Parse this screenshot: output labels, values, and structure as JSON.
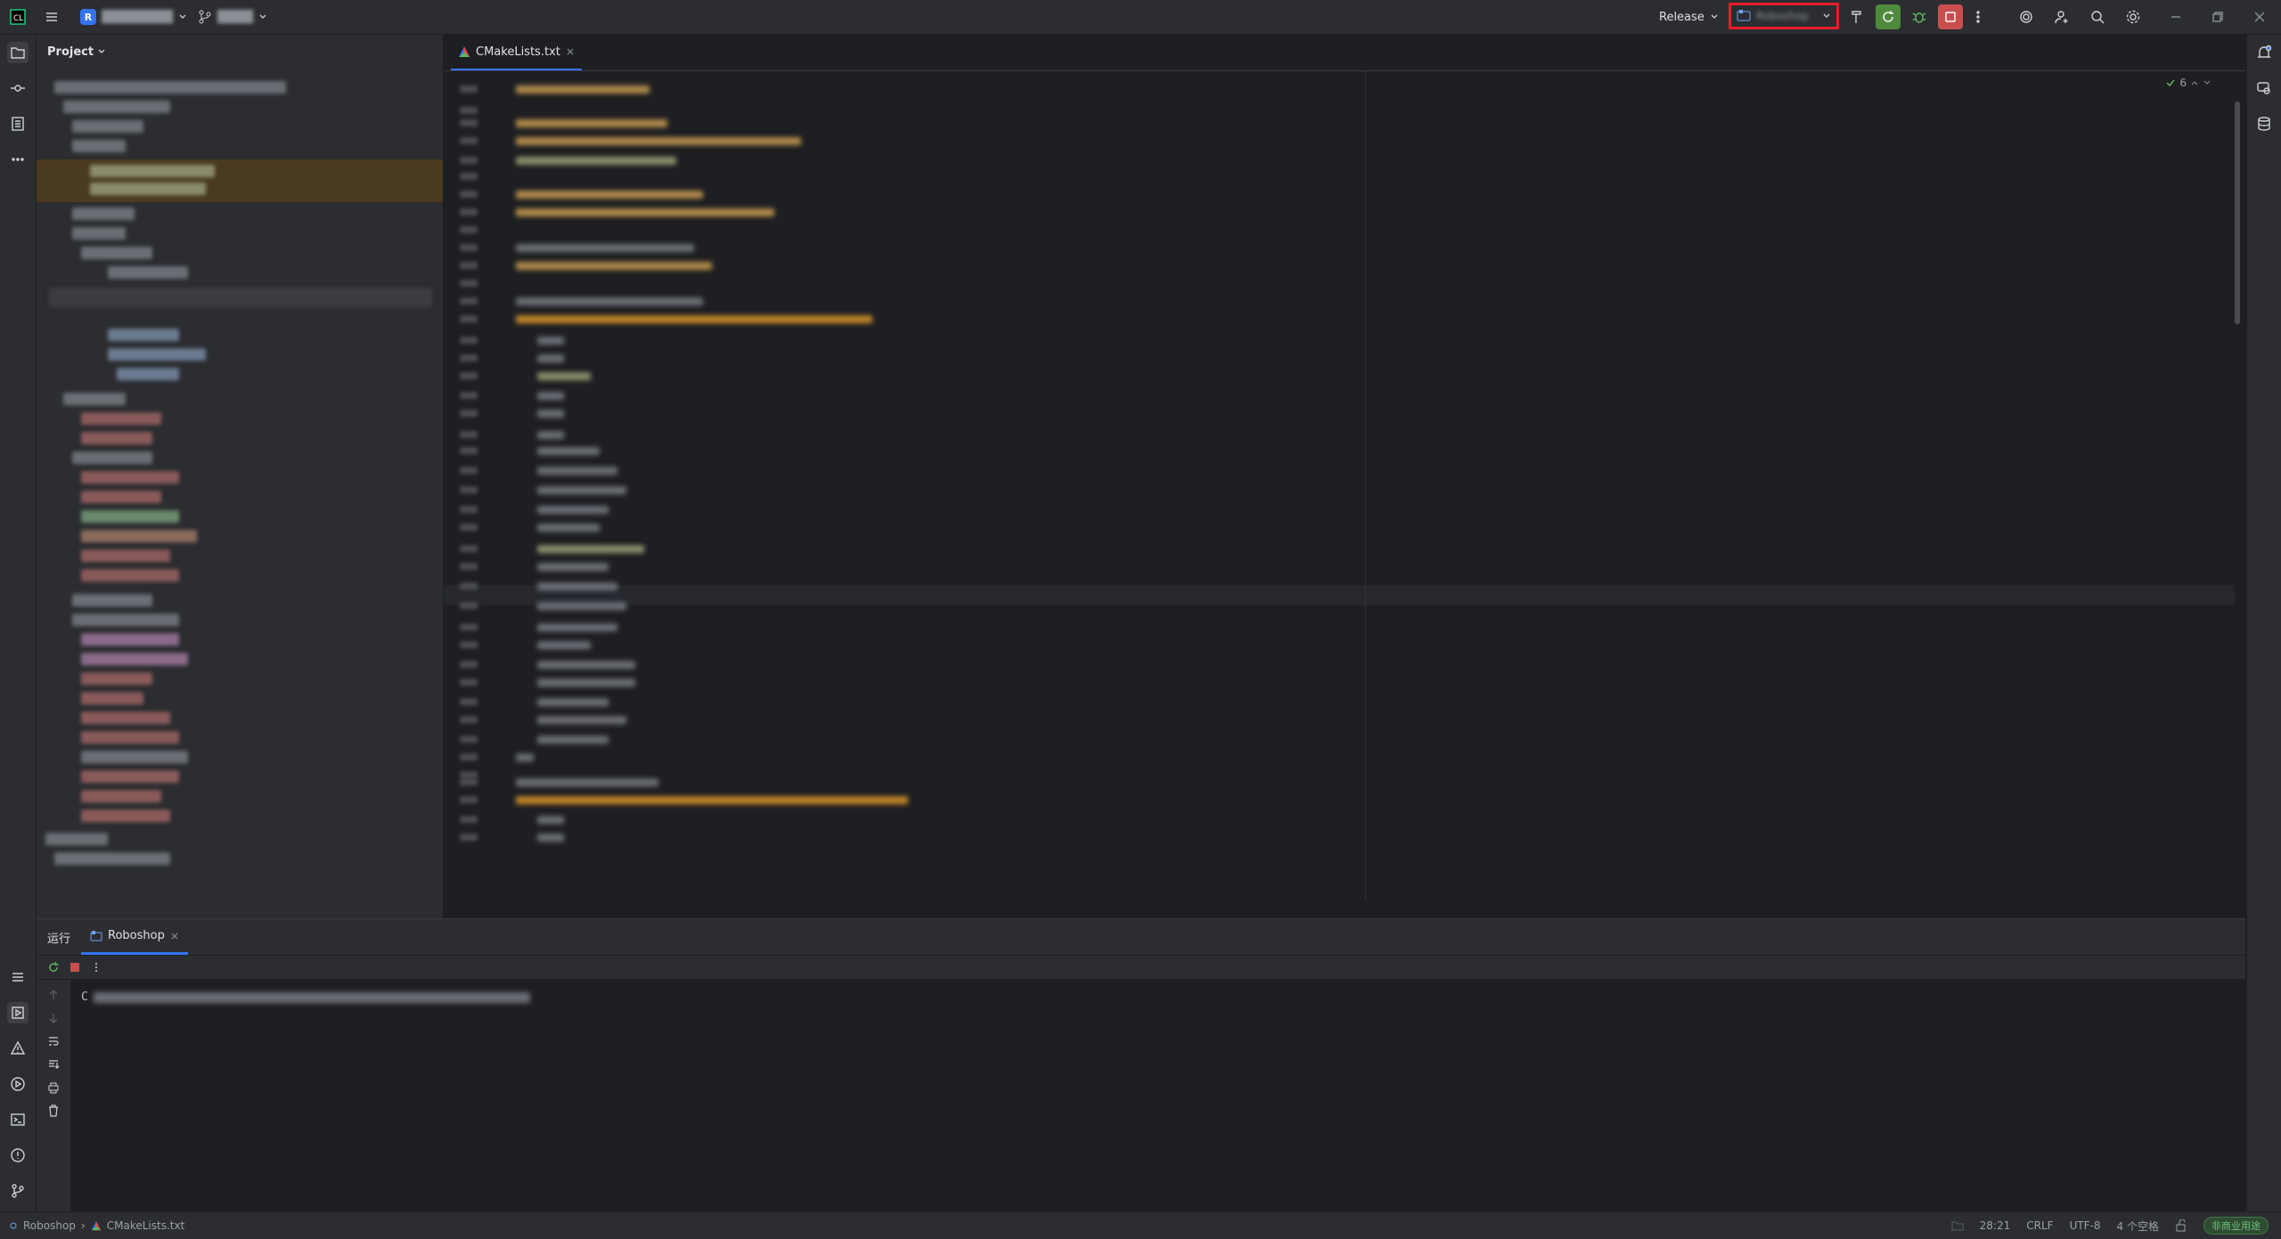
{
  "titlebar": {
    "project_badge": "R",
    "build_config": "Release",
    "config_name": "Roboshop"
  },
  "project_panel": {
    "title": "Project"
  },
  "editor": {
    "tab_label": "CMakeLists.txt",
    "inspection_count": "6"
  },
  "run_panel": {
    "title": "运行",
    "tab_label": "Roboshop",
    "console_prefix": "C"
  },
  "statusbar": {
    "breadcrumb_project": "Roboshop",
    "breadcrumb_file": "CMakeLists.txt",
    "cursor_position": "28:21",
    "line_separator": "CRLF",
    "encoding": "UTF-8",
    "indent": "4 个空格",
    "license": "非商业用途"
  },
  "colors": {
    "accent": "#3574f0",
    "highlight_box": "#e41e2a",
    "run_green": "#4e8a3e",
    "stop_red": "#c94f4f"
  }
}
